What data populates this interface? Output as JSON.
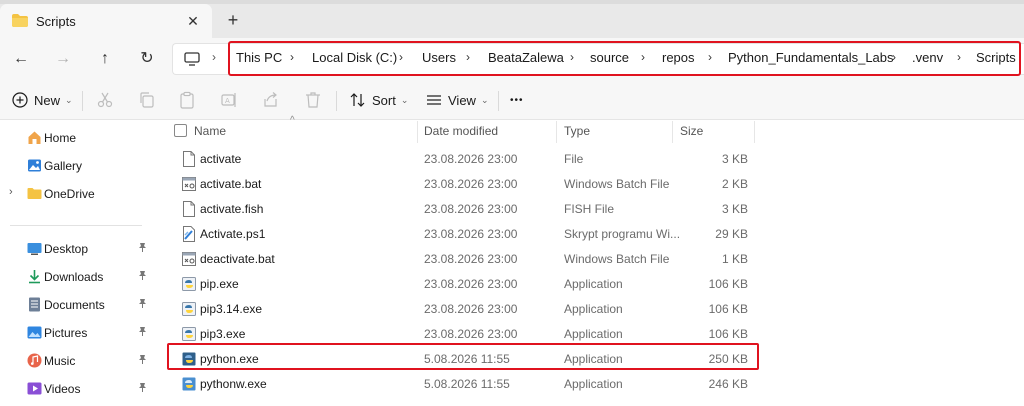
{
  "window": {
    "tab_title": "Scripts",
    "close_glyph": "✕",
    "new_tab_glyph": "+"
  },
  "nav": {
    "back_glyph": "←",
    "forward_glyph": "→",
    "up_glyph": "↑",
    "refresh_glyph": "↻",
    "chevron_glyph": "›",
    "breadcrumbs": [
      "This PC",
      "Local Disk (C:)",
      "Users",
      "BeataZalewa",
      "source",
      "repos",
      "Python_Fundamentals_Labs",
      ".venv",
      "Scripts"
    ]
  },
  "commands": {
    "new_label": "New",
    "sort_label": "Sort",
    "view_label": "View",
    "more_glyph": "•••",
    "dropdown_glyph": "⌄"
  },
  "sidebar": {
    "items": [
      {
        "label": "Home",
        "icon": "home-icon"
      },
      {
        "label": "Gallery",
        "icon": "gallery-icon"
      },
      {
        "label": "OneDrive",
        "icon": "onedrive-folder-icon"
      },
      {
        "label": "Desktop",
        "icon": "desktop-icon"
      },
      {
        "label": "Downloads",
        "icon": "downloads-icon"
      },
      {
        "label": "Documents",
        "icon": "documents-icon"
      },
      {
        "label": "Pictures",
        "icon": "pictures-icon"
      },
      {
        "label": "Music",
        "icon": "music-icon"
      },
      {
        "label": "Videos",
        "icon": "videos-icon"
      }
    ],
    "expand_glyph": "›",
    "pin_glyph": "📌"
  },
  "files": {
    "columns": {
      "name": "Name",
      "date": "Date modified",
      "type": "Type",
      "size": "Size"
    },
    "sort_caret": "^",
    "rows": [
      {
        "name": "activate",
        "date": "23.08.2026 23:00",
        "type": "File",
        "size": "3 KB",
        "icon": "file-icon"
      },
      {
        "name": "activate.bat",
        "date": "23.08.2026 23:00",
        "type": "Windows Batch File",
        "size": "2 KB",
        "icon": "batch-file-icon"
      },
      {
        "name": "activate.fish",
        "date": "23.08.2026 23:00",
        "type": "FISH File",
        "size": "3 KB",
        "icon": "file-icon"
      },
      {
        "name": "Activate.ps1",
        "date": "23.08.2026 23:00",
        "type": "Skrypt programu Wi...",
        "size": "29 KB",
        "icon": "powershell-script-icon"
      },
      {
        "name": "deactivate.bat",
        "date": "23.08.2026 23:00",
        "type": "Windows Batch File",
        "size": "1 KB",
        "icon": "batch-file-icon"
      },
      {
        "name": "pip.exe",
        "date": "23.08.2026 23:00",
        "type": "Application",
        "size": "106 KB",
        "icon": "python-exe-icon"
      },
      {
        "name": "pip3.14.exe",
        "date": "23.08.2026 23:00",
        "type": "Application",
        "size": "106 KB",
        "icon": "python-exe-icon"
      },
      {
        "name": "pip3.exe",
        "date": "23.08.2026 23:00",
        "type": "Application",
        "size": "106 KB",
        "icon": "python-exe-icon"
      },
      {
        "name": "python.exe",
        "date": "5.08.2026 11:55",
        "type": "Application",
        "size": "250 KB",
        "icon": "python-app-icon"
      },
      {
        "name": "pythonw.exe",
        "date": "5.08.2026 11:55",
        "type": "Application",
        "size": "246 KB",
        "icon": "python-app-icon"
      }
    ]
  },
  "colors": {
    "highlight": "#e0131f",
    "folder": "#f4c343",
    "accent": "#1f6fd1"
  }
}
